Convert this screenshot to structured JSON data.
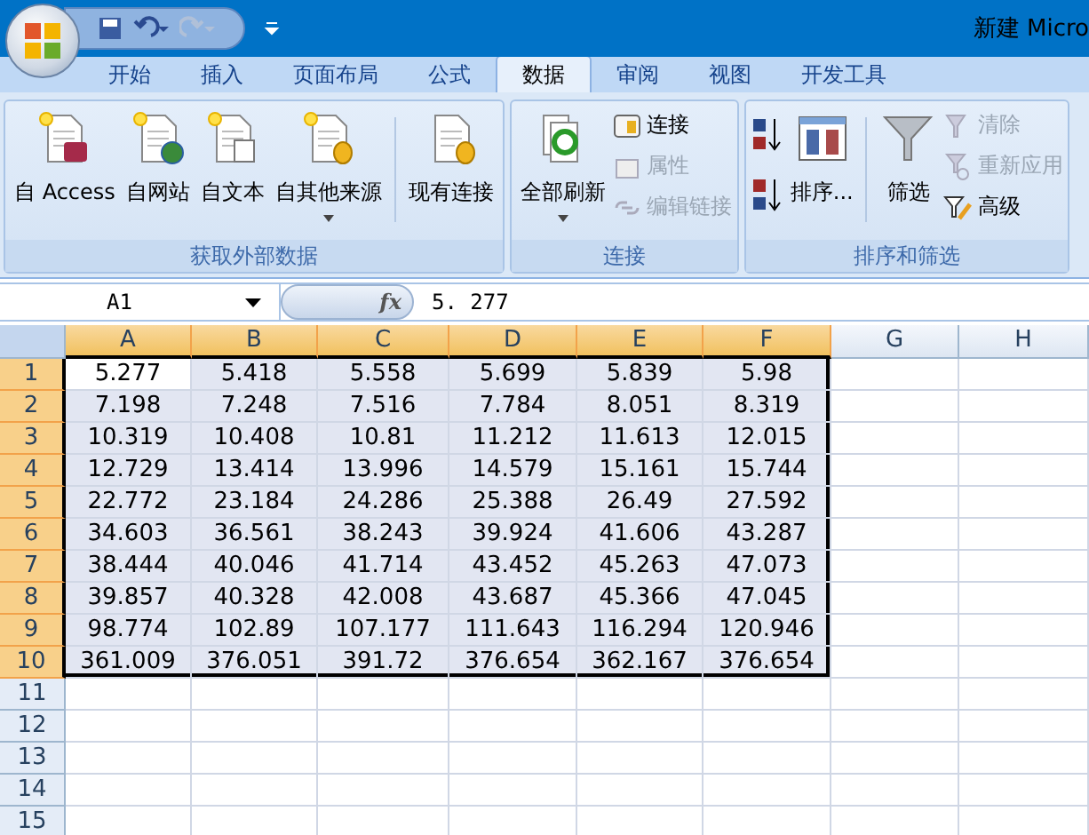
{
  "title": "新建 Micro",
  "tabs": [
    {
      "label": "开始",
      "selected": false
    },
    {
      "label": "插入",
      "selected": false
    },
    {
      "label": "页面布局",
      "selected": false
    },
    {
      "label": "公式",
      "selected": false
    },
    {
      "label": "数据",
      "selected": true
    },
    {
      "label": "审阅",
      "selected": false
    },
    {
      "label": "视图",
      "selected": false
    },
    {
      "label": "开发工具",
      "selected": false
    }
  ],
  "ribbon_groups": [
    {
      "label": "获取外部数据",
      "items": [
        {
          "kind": "large",
          "label": "自 Access",
          "disabled": false,
          "dropdown": false
        },
        {
          "kind": "large",
          "label": "自网站",
          "disabled": false,
          "dropdown": false
        },
        {
          "kind": "large",
          "label": "自文本",
          "disabled": false,
          "dropdown": false
        },
        {
          "kind": "large",
          "label": "自其他来源",
          "disabled": false,
          "dropdown": true
        },
        {
          "kind": "separator"
        },
        {
          "kind": "large",
          "label": "现有连接",
          "disabled": false,
          "dropdown": false
        }
      ]
    },
    {
      "label": "连接",
      "items": [
        {
          "kind": "large",
          "label": "全部刷新",
          "disabled": false,
          "dropdown": true
        },
        {
          "kind": "small",
          "label": "连接",
          "disabled": false
        },
        {
          "kind": "small",
          "label": "属性",
          "disabled": true
        },
        {
          "kind": "small",
          "label": "编辑链接",
          "disabled": true
        }
      ]
    },
    {
      "label": "排序和筛选",
      "items": [
        {
          "kind": "icon",
          "disabled": false
        },
        {
          "kind": "icon",
          "disabled": false
        },
        {
          "kind": "large",
          "label": "排序...",
          "disabled": false,
          "dropdown": false
        },
        {
          "kind": "separator"
        },
        {
          "kind": "large",
          "label": "筛选",
          "disabled": false,
          "dropdown": false
        },
        {
          "kind": "small",
          "label": "清除",
          "disabled": true
        },
        {
          "kind": "small",
          "label": "重新应用",
          "disabled": true
        },
        {
          "kind": "small",
          "label": "高级",
          "disabled": false
        }
      ]
    }
  ],
  "formula_bar": {
    "name_box": "A1",
    "fx": "fx",
    "value": "5. 277"
  },
  "columns": [
    {
      "label": "A",
      "selected": true
    },
    {
      "label": "B",
      "selected": true
    },
    {
      "label": "C",
      "selected": true
    },
    {
      "label": "D",
      "selected": true
    },
    {
      "label": "E",
      "selected": true
    },
    {
      "label": "F",
      "selected": true
    },
    {
      "label": "G",
      "selected": false
    },
    {
      "label": "H",
      "selected": false
    }
  ],
  "rows": [
    {
      "label": "1",
      "selected": true,
      "cells": [
        "5.277",
        "5.418",
        "5.558",
        "5.699",
        "5.839",
        "5.98"
      ]
    },
    {
      "label": "2",
      "selected": true,
      "cells": [
        "7.198",
        "7.248",
        "7.516",
        "7.784",
        "8.051",
        "8.319"
      ]
    },
    {
      "label": "3",
      "selected": true,
      "cells": [
        "10.319",
        "10.408",
        "10.81",
        "11.212",
        "11.613",
        "12.015"
      ]
    },
    {
      "label": "4",
      "selected": true,
      "cells": [
        "12.729",
        "13.414",
        "13.996",
        "14.579",
        "15.161",
        "15.744"
      ]
    },
    {
      "label": "5",
      "selected": true,
      "cells": [
        "22.772",
        "23.184",
        "24.286",
        "25.388",
        "26.49",
        "27.592"
      ]
    },
    {
      "label": "6",
      "selected": true,
      "cells": [
        "34.603",
        "36.561",
        "38.243",
        "39.924",
        "41.606",
        "43.287"
      ]
    },
    {
      "label": "7",
      "selected": true,
      "cells": [
        "38.444",
        "40.046",
        "41.714",
        "43.452",
        "45.263",
        "47.073"
      ]
    },
    {
      "label": "8",
      "selected": true,
      "cells": [
        "39.857",
        "40.328",
        "42.008",
        "43.687",
        "45.366",
        "47.045"
      ]
    },
    {
      "label": "9",
      "selected": true,
      "cells": [
        "98.774",
        "102.89",
        "107.177",
        "111.643",
        "116.294",
        "120.946"
      ]
    },
    {
      "label": "10",
      "selected": true,
      "cells": [
        "361.009",
        "376.051",
        "391.72",
        "376.654",
        "362.167",
        "376.654"
      ]
    },
    {
      "label": "11",
      "selected": false
    },
    {
      "label": "12",
      "selected": false
    },
    {
      "label": "13",
      "selected": false
    },
    {
      "label": "14",
      "selected": false
    },
    {
      "label": "15",
      "selected": false
    }
  ]
}
